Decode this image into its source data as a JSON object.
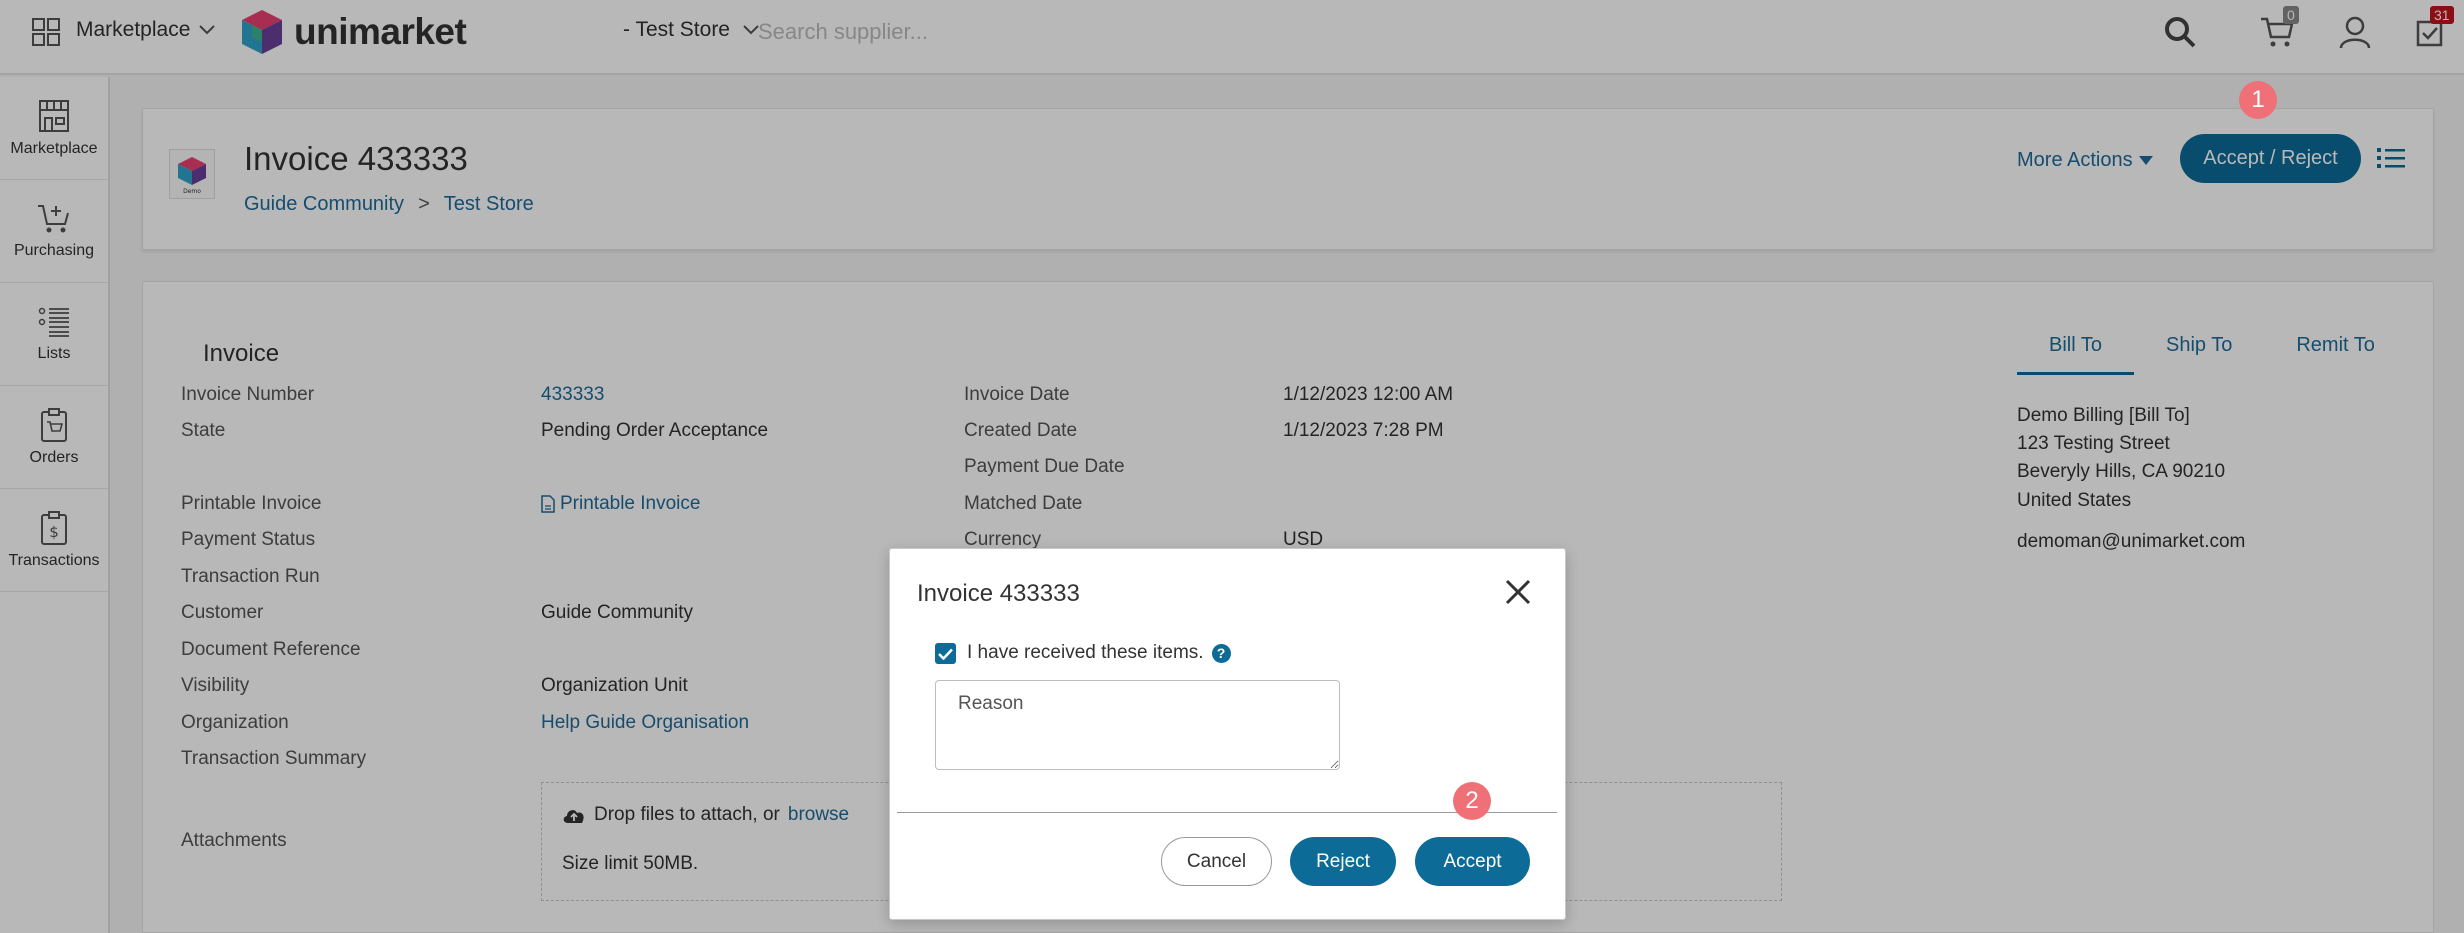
{
  "topbar": {
    "marketplace_label": "Marketplace",
    "logo_text": "unimarket",
    "store_label": "- Test Store",
    "search_placeholder": "Search supplier...",
    "cart_count": "0",
    "tasks_count": "31"
  },
  "sidebar": {
    "items": [
      {
        "label": "Marketplace",
        "icon": "storefront-icon"
      },
      {
        "label": "Purchasing",
        "icon": "cart-add-icon"
      },
      {
        "label": "Lists",
        "icon": "list-icon"
      },
      {
        "label": "Orders",
        "icon": "order-clipboard-icon"
      },
      {
        "label": "Transactions",
        "icon": "transaction-doc-icon"
      }
    ]
  },
  "header": {
    "title": "Invoice 433333",
    "logo_caption": "Demo",
    "breadcrumb": [
      "Guide Community",
      "Test Store"
    ],
    "breadcrumb_sep": ">",
    "more_actions": "More Actions",
    "accept_reject": "Accept / Reject"
  },
  "markers": {
    "one": "1",
    "two": "2"
  },
  "details": {
    "section_title": "Invoice",
    "left_fields": {
      "invoice_number_label": "Invoice Number",
      "invoice_number": "433333",
      "state_label": "State",
      "state": "Pending Order Acceptance",
      "printable_label": "Printable Invoice",
      "printable_link": "Printable Invoice",
      "payment_status_label": "Payment Status",
      "transaction_run_label": "Transaction Run",
      "customer_label": "Customer",
      "customer": "Guide Community",
      "doc_ref_label": "Document Reference",
      "visibility_label": "Visibility",
      "visibility": "Organization Unit",
      "organization_label": "Organization",
      "organization": "Help Guide Organisation",
      "transaction_summary_label": "Transaction Summary",
      "attachments_label": "Attachments"
    },
    "right_fields": {
      "invoice_date_label": "Invoice Date",
      "invoice_date": "1/12/2023 12:00 AM",
      "created_date_label": "Created Date",
      "created_date": "1/12/2023 7:28 PM",
      "payment_due_label": "Payment Due Date",
      "matched_date_label": "Matched Date",
      "currency_label": "Currency",
      "currency": "USD"
    },
    "tabs": [
      "Bill To",
      "Ship To",
      "Remit To"
    ],
    "address": [
      "Demo Billing [Bill To]",
      "123 Testing Street",
      "Beveryly Hills, CA 90210",
      "United States"
    ],
    "email": "demoman@unimarket.com",
    "dropzone": {
      "text": "Drop files to attach, or",
      "browse": "browse",
      "size_limit": "Size limit 50MB."
    }
  },
  "modal": {
    "title": "Invoice 433333",
    "checkbox_label": "I have received these items.",
    "checkbox_checked": true,
    "help": "?",
    "reason_placeholder": "Reason",
    "cancel": "Cancel",
    "reject": "Reject",
    "accept": "Accept"
  },
  "colors": {
    "primary": "#0c6b97",
    "link": "#1f6b9a",
    "marker": "#f07078",
    "badge_cart": "#888888",
    "badge_tasks": "#c0141c"
  }
}
